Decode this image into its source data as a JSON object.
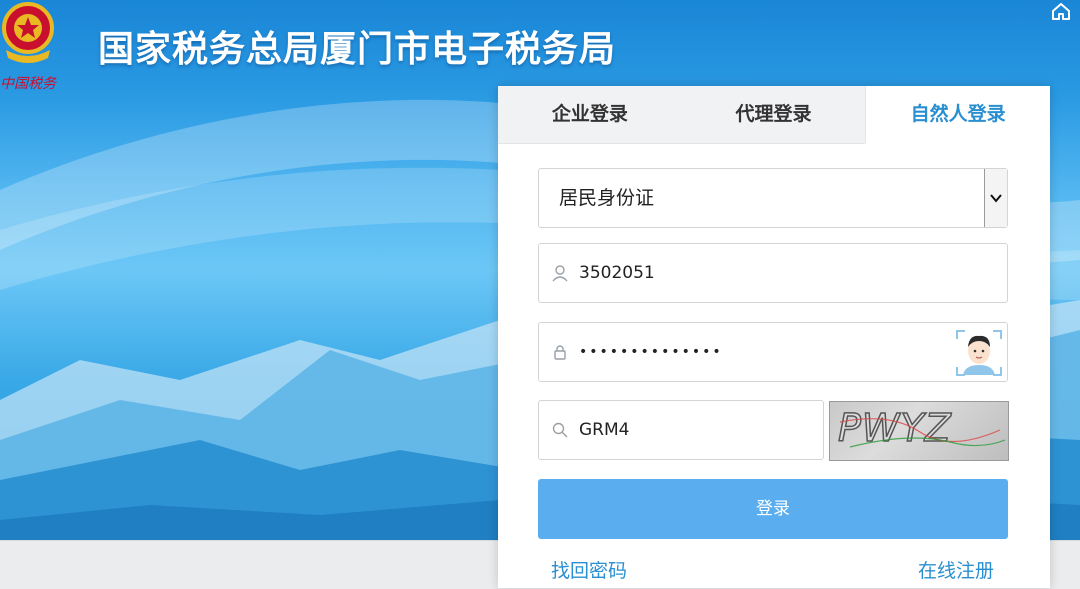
{
  "header": {
    "title": "国家税务总局厦门市电子税务局",
    "emblem_caption": "中国税务"
  },
  "login": {
    "tabs": [
      {
        "label": "企业登录",
        "active": false
      },
      {
        "label": "代理登录",
        "active": false
      },
      {
        "label": "自然人登录",
        "active": true
      }
    ],
    "id_type": {
      "selected": "居民身份证"
    },
    "username": {
      "value": "3502051"
    },
    "password": {
      "value": "••••••••••••••"
    },
    "captcha": {
      "value": "GRM4",
      "image_text": "PWYZ"
    },
    "submit_label": "登录",
    "forgot_label": "找回密码",
    "register_label": "在线注册"
  },
  "colors": {
    "accent": "#2a8fd0",
    "button": "#5aaef0",
    "banner": "#2a9ae3"
  },
  "icons": [
    "home-icon",
    "user-icon",
    "lock-icon",
    "search-icon",
    "face-scan-icon",
    "chevron-down-icon"
  ]
}
